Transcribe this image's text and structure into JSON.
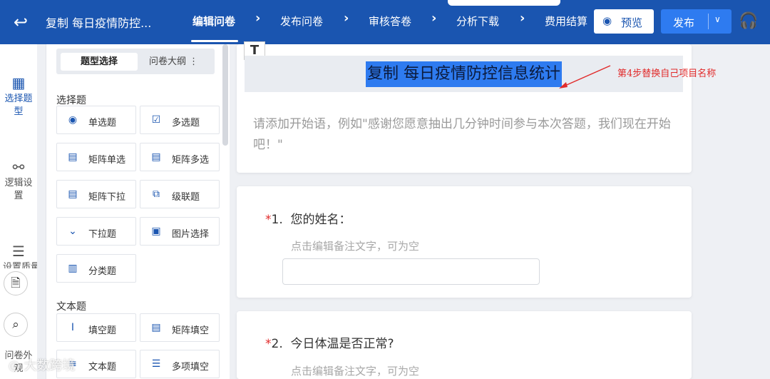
{
  "header": {
    "doc_title": "复制 每日疫情防控...",
    "steps": [
      "编辑问卷",
      "发布问卷",
      "审核答卷",
      "分析下载",
      "费用结算"
    ],
    "preview_label": "预览",
    "publish_label": "发布"
  },
  "rail": {
    "items": [
      {
        "label": "选择题型",
        "icon": "grid-icon"
      },
      {
        "label": "逻辑设置",
        "icon": "logic-icon"
      },
      {
        "label": "设置质量",
        "icon": "sliders-icon"
      },
      {
        "label": "问卷外观",
        "icon": "appearance-icon"
      }
    ]
  },
  "panel": {
    "tabs": {
      "active": "题型选择",
      "other": "问卷大纲 ⋮"
    },
    "choice_section": "选择题",
    "choice_items": [
      "单选题",
      "多选题",
      "矩阵单选",
      "矩阵多选",
      "矩阵下拉",
      "级联题",
      "下拉题",
      "图片选择",
      "分类题"
    ],
    "text_section": "文本题",
    "text_items": [
      "填空题",
      "矩阵填空",
      "文本题",
      "多项填空"
    ]
  },
  "canvas": {
    "title": "复制 每日疫情防控信息统计",
    "annotation": "第4步替换自己项目名称",
    "intro": "请添加开始语，例如\"感谢您愿意抽出几分钟时间参与本次答题，我们现在开始吧！\"",
    "questions": [
      {
        "required": "*",
        "number": "1.",
        "text": "您的姓名：",
        "note": "点击编辑备注文字，可为空"
      },
      {
        "required": "*",
        "number": "2.",
        "text": "今日体温是否正常?",
        "note": "点击编辑备注文字，可为空"
      }
    ]
  },
  "watermark": "大数跨境",
  "colors": {
    "topbar": "#1a55b0",
    "accent": "#2e7bf0",
    "required": "#e12a2a",
    "annotation": "#e12a2a"
  }
}
